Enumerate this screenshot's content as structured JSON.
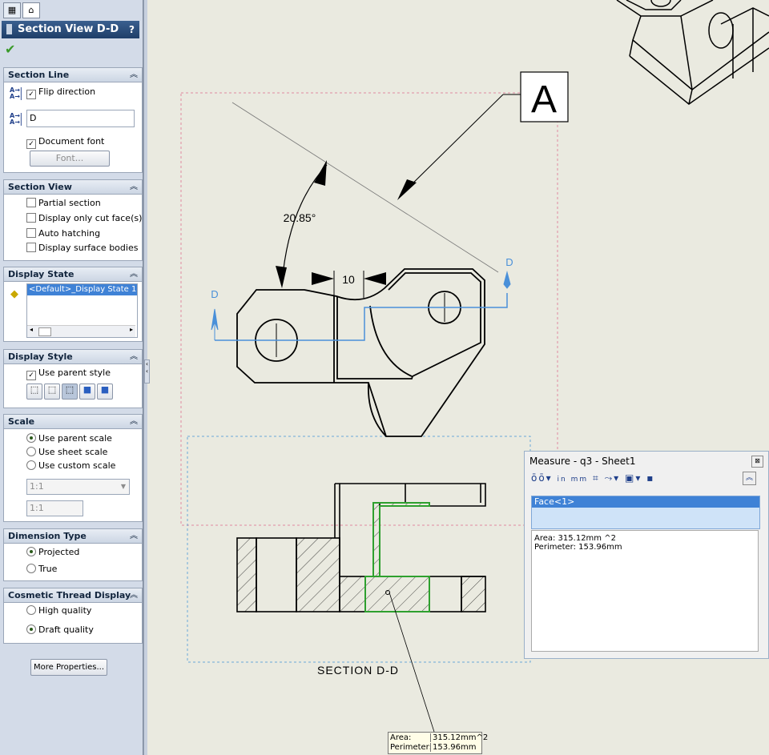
{
  "property_manager": {
    "title": "Section View D-D",
    "help": "?",
    "ok_icon": "green-checkmark-icon",
    "groups": {
      "section_line": {
        "title": "Section Line",
        "flip_direction": "Flip direction",
        "label_value": "D",
        "document_font": "Document font",
        "font_button": "Font..."
      },
      "section_view": {
        "title": "Section View",
        "partial_section": "Partial section",
        "display_only_cut_faces": "Display only cut face(s)",
        "auto_hatching": "Auto hatching",
        "display_surface_bodies": "Display surface bodies"
      },
      "display_state": {
        "title": "Display State",
        "selected_item": "<Default>_Display State 1"
      },
      "display_style": {
        "title": "Display Style",
        "use_parent_style": "Use parent style"
      },
      "scale": {
        "title": "Scale",
        "use_parent_scale": "Use parent scale",
        "use_sheet_scale": "Use sheet scale",
        "use_custom_scale": "Use custom scale",
        "dropdown_value": "1:1",
        "custom_value": "1:1"
      },
      "dimension_type": {
        "title": "Dimension Type",
        "projected": "Projected",
        "true": "True"
      },
      "cosmetic_thread_display": {
        "title": "Cosmetic Thread Display",
        "high_quality": "High quality",
        "draft_quality": "Draft quality"
      }
    },
    "more_properties": "More Properties..."
  },
  "drawing": {
    "detail_label": "A",
    "angle_dimension": "20.85°",
    "linear_dimension": "10",
    "section_arrow_left": "D",
    "section_arrow_right": "D",
    "section_caption": "SECTION D-D",
    "tooltip": {
      "area_label": "Area:",
      "area_value": "315.12mm^2",
      "perimeter_label": "Perimeter:",
      "perimeter_value": "153.96mm"
    }
  },
  "measure_window": {
    "title": "Measure - q3 - Sheet1",
    "close": "⊠",
    "selection": "Face<1>",
    "result_area": "Area: 315.12mm ^2",
    "result_perimeter": "Perimeter: 153.96mm",
    "units_label": "in mm"
  },
  "colors": {
    "section_line": "#4a90d9",
    "selected_face": "#2ea02e",
    "view_boundary_red": "#e08aa0",
    "view_boundary_blue": "#6aa8d8"
  }
}
